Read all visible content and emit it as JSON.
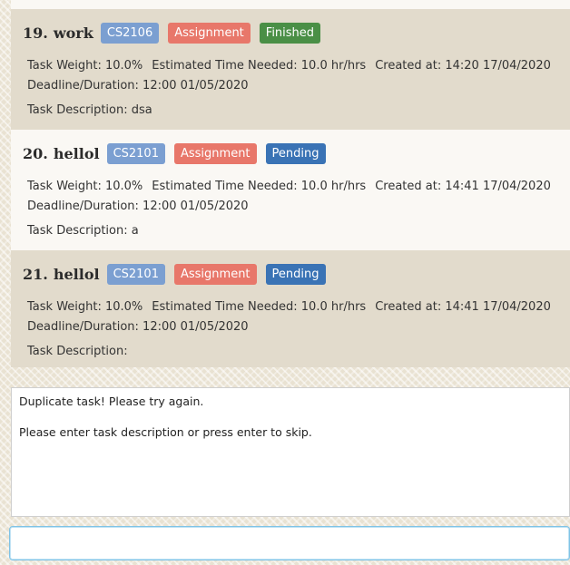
{
  "tasks": [
    {
      "index": "19.",
      "name": "work",
      "tags": [
        {
          "label": "CS2106",
          "color": "#7b9fd1"
        },
        {
          "label": "Assignment",
          "color": "#e8776a"
        },
        {
          "label": "Finished",
          "color": "#4a8f46"
        }
      ],
      "weight": "Task Weight: 10.0%",
      "time": "Estimated Time Needed: 10.0 hr/hrs",
      "created": "Created at: 14:20 17/04/2020",
      "deadline": "Deadline/Duration: 12:00 01/05/2020",
      "description": "Task Description: dsa"
    },
    {
      "index": "20.",
      "name": "hellol",
      "tags": [
        {
          "label": "CS2101",
          "color": "#7b9fd1"
        },
        {
          "label": "Assignment",
          "color": "#e8776a"
        },
        {
          "label": "Pending",
          "color": "#3a73b5"
        }
      ],
      "weight": "Task Weight: 10.0%",
      "time": "Estimated Time Needed: 10.0 hr/hrs",
      "created": "Created at: 14:41 17/04/2020",
      "deadline": "Deadline/Duration: 12:00 01/05/2020",
      "description": "Task Description: a"
    },
    {
      "index": "21.",
      "name": "hellol",
      "tags": [
        {
          "label": "CS2101",
          "color": "#7b9fd1"
        },
        {
          "label": "Assignment",
          "color": "#e8776a"
        },
        {
          "label": "Pending",
          "color": "#3a73b5"
        }
      ],
      "weight": "Task Weight: 10.0%",
      "time": "Estimated Time Needed: 10.0 hr/hrs",
      "created": "Created at: 14:41 17/04/2020",
      "deadline": "Deadline/Duration: 12:00 01/05/2020",
      "description": "Task Description:"
    }
  ],
  "result": {
    "line1": "Duplicate task! Please try again.",
    "line2": "Please enter task description or press enter to skip."
  },
  "command": {
    "value": "",
    "placeholder": ""
  }
}
